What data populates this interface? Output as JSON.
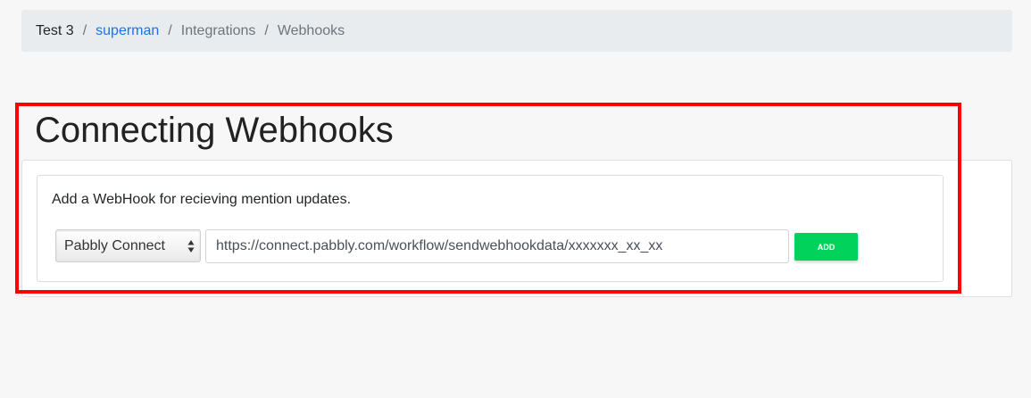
{
  "breadcrumb": {
    "items": [
      {
        "label": "Test 3"
      },
      {
        "label": "superman"
      },
      {
        "label": "Integrations"
      },
      {
        "label": "Webhooks"
      }
    ],
    "separator": "/"
  },
  "page": {
    "title": "Connecting Webhooks"
  },
  "webhook_form": {
    "description": "Add a WebHook for recieving mention updates.",
    "select_value": "Pabbly Connect",
    "url_value": "https://connect.pabbly.com/workflow/sendwebhookdata/xxxxxxx_xx_xx",
    "add_label": "ADD"
  },
  "colors": {
    "link": "#1a73e8",
    "add_button": "#00d25b",
    "highlight": "#ff0000",
    "breadcrumb_bg": "#e9ecef"
  }
}
